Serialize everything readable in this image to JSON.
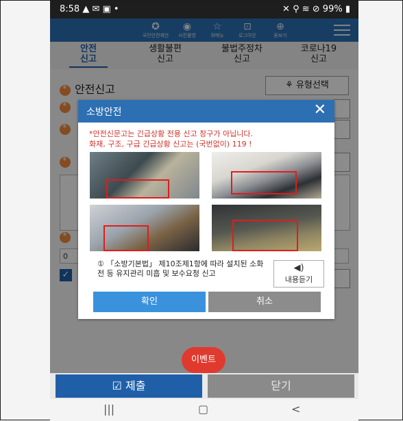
{
  "status": {
    "time": "8:58",
    "battery": "99%",
    "left_icons": "▲ ✉ ▣ •",
    "right_icons": "✕ ⚲ ≋ ⊘"
  },
  "appbar": {
    "icons": [
      {
        "label": "국민안전제안",
        "icon": "people-icon",
        "glyph": "✪"
      },
      {
        "label": "사진촬영",
        "icon": "camera-icon",
        "glyph": "◉"
      },
      {
        "label": "위메뉴",
        "icon": "star-icon",
        "glyph": "☆"
      },
      {
        "label": "로그아웃",
        "icon": "lock-icon",
        "glyph": "⊡"
      },
      {
        "label": "돋보기",
        "icon": "zoom-icon",
        "glyph": "⊕"
      }
    ]
  },
  "tabs": [
    {
      "line1": "안전",
      "line2": "신고"
    },
    {
      "line1": "생활불편",
      "line2": "신고"
    },
    {
      "line1": "불법주정차",
      "line2": "신고"
    },
    {
      "line1": "코로나19",
      "line2": "신고"
    }
  ],
  "main": {
    "section_title": "안전신고",
    "type_select": "유형선택",
    "field_prefix": "0"
  },
  "modal": {
    "title": "소방안전",
    "warn_line1": "*안전신문고는 긴급상황 전용 신고 창구가 아닙니다.",
    "warn_line2": "화재, 구조, 구급 긴급상황 신고는 (국번없이) 119 !",
    "description": "① 「소방기본법」 제10조제1항에 따라 설치된 소화전 등 유지관리 미흡 및 보수요청 신고",
    "listen_label": "내용듣기",
    "confirm": "확인",
    "cancel": "취소"
  },
  "event": "이벤트",
  "bottom": {
    "submit": "제출",
    "close": "닫기"
  },
  "navbar": {
    "recent": "|||",
    "home": "▢",
    "back": "<"
  },
  "colors": {
    "primary": "#2d6fb3",
    "accent_red": "#e03a2e",
    "warn": "#d0302a"
  }
}
